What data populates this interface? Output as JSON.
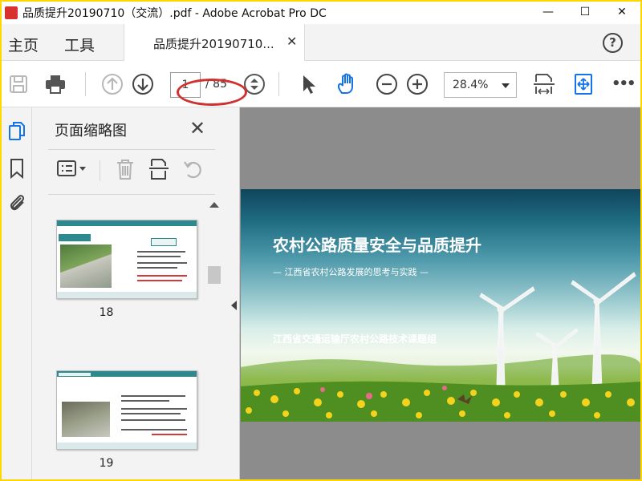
{
  "window": {
    "title": "品质提升20190710（交流）.pdf - Adobe Acrobat Pro DC",
    "minimize_glyph": "—",
    "maximize_glyph": "☐",
    "close_glyph": "✕"
  },
  "menubar": {
    "home": "主页",
    "tools": "工具",
    "tab_label": "品质提升20190710...",
    "tab_close": "✕",
    "help": "?"
  },
  "toolbar": {
    "current_page": "1",
    "page_total": "/ 85",
    "zoom": "28.4%",
    "more": "•••"
  },
  "panel": {
    "title": "页面缩略图",
    "close": "✕",
    "thumbnails": [
      {
        "page_label": "18"
      },
      {
        "page_label": "19"
      }
    ]
  },
  "slide": {
    "title": "农村公路质量安全与品质提升",
    "subtitle": "—   江西省农村公路发展的思考与实践   —",
    "organization": "江西省交通运输厅农村公路技术课题组"
  },
  "colors": {
    "annotation_ellipse": "#d03030",
    "app_icon": "#d8322e",
    "window_border": "#ffd700",
    "thumb_accent": "#2c8a8e",
    "doc_background": "#8c8c8c"
  }
}
